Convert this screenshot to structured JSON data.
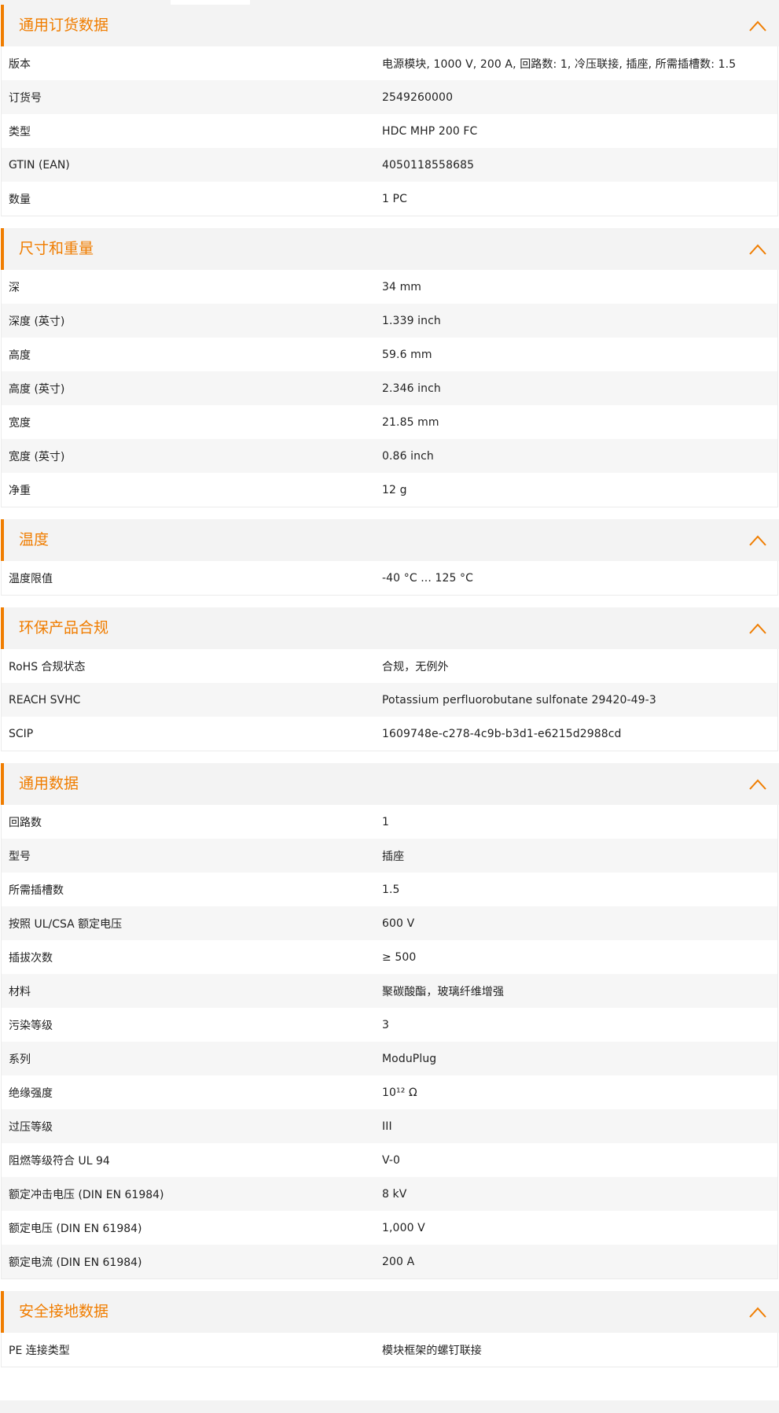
{
  "colors": {
    "accent": "#f07d00",
    "header_bg": "#f3f3f3",
    "row_alt_bg": "#f6f6f6"
  },
  "sections": [
    {
      "title": "通用订货数据",
      "rows": [
        {
          "label": "版本",
          "value": "电源模块, 1000 V, 200 A, 回路数: 1, 冷压联接, 插座, 所需插槽数: 1.5"
        },
        {
          "label": "订货号",
          "value": "2549260000"
        },
        {
          "label": "类型",
          "value": "HDC MHP 200 FC"
        },
        {
          "label": "GTIN (EAN)",
          "value": "4050118558685"
        },
        {
          "label": "数量",
          "value": "1  PC"
        }
      ]
    },
    {
      "title": "尺寸和重量",
      "rows": [
        {
          "label": "深",
          "value": "34  mm"
        },
        {
          "label": "深度 (英寸)",
          "value": "1.339  inch"
        },
        {
          "label": "高度",
          "value": "59.6  mm"
        },
        {
          "label": "高度 (英寸)",
          "value": "2.346  inch"
        },
        {
          "label": "宽度",
          "value": "21.85  mm"
        },
        {
          "label": "宽度 (英寸)",
          "value": "0.86  inch"
        },
        {
          "label": "净重",
          "value": "12  g"
        }
      ]
    },
    {
      "title": "温度",
      "rows": [
        {
          "label": "温度限值",
          "value": "-40 °C ... 125 °C"
        }
      ]
    },
    {
      "title": "环保产品合规",
      "rows": [
        {
          "label": "RoHS 合规状态",
          "value": "合规，无例外"
        },
        {
          "label": "REACH SVHC",
          "value": "Potassium perfluorobutane sulfonate 29420-49-3"
        },
        {
          "label": "SCIP",
          "value": "1609748e-c278-4c9b-b3d1-e6215d2988cd"
        }
      ]
    },
    {
      "title": "通用数据",
      "rows": [
        {
          "label": "回路数",
          "value": "1"
        },
        {
          "label": "型号",
          "value": "插座"
        },
        {
          "label": "所需插槽数",
          "value": "1.5"
        },
        {
          "label": "按照 UL/CSA 额定电压",
          "value": "600 V"
        },
        {
          "label": "插拔次数",
          "value": "≥ 500"
        },
        {
          "label": "材料",
          "value": "聚碳酸酯，玻璃纤维增强"
        },
        {
          "label": "污染等级",
          "value": "3"
        },
        {
          "label": "系列",
          "value": "ModuPlug"
        },
        {
          "label": "绝缘强度",
          "value": "10¹² Ω"
        },
        {
          "label": "过压等级",
          "value": "III"
        },
        {
          "label": "阻燃等级符合 UL 94",
          "value": "V-0"
        },
        {
          "label": "额定冲击电压 (DIN EN 61984)",
          "value": "8  kV"
        },
        {
          "label": "额定电压 (DIN EN 61984)",
          "value": "1,000  V"
        },
        {
          "label": "额定电流 (DIN EN 61984)",
          "value": "200  A"
        }
      ]
    },
    {
      "title": "安全接地数据",
      "rows": [
        {
          "label": "PE 连接类型",
          "value": "模块框架的螺钉联接"
        }
      ]
    }
  ]
}
